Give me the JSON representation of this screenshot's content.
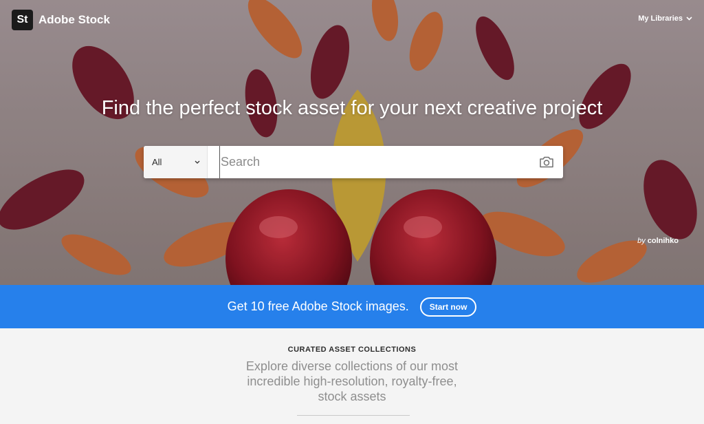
{
  "header": {
    "logo_badge": "St",
    "logo_text": "Adobe Stock",
    "my_libraries": "My Libraries"
  },
  "hero": {
    "title": "Find the perfect stock asset for your next creative project",
    "credit_prefix": "by",
    "credit_author": "colnihko"
  },
  "search": {
    "type_value": "All",
    "placeholder": "Search"
  },
  "promo": {
    "text": "Get 10 free Adobe Stock images.",
    "button": "Start now"
  },
  "curated": {
    "label": "CURATED ASSET COLLECTIONS",
    "description": "Explore diverse collections of our most incredible high-resolution, royalty-free, stock assets"
  },
  "colors": {
    "promo_blue": "#2680eb",
    "logo_dark": "#1b1b1b"
  },
  "icons": [
    "adobe-stock-logo-icon",
    "chevron-down-icon",
    "camera-icon"
  ]
}
